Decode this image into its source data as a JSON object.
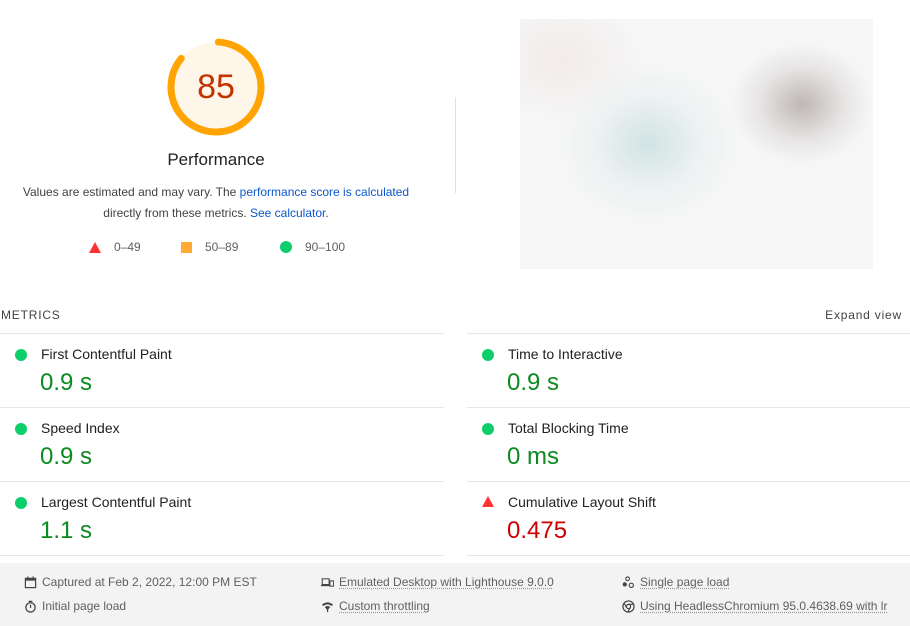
{
  "gauge": {
    "score": "85",
    "score_fraction": 0.85,
    "title": "Performance",
    "ring_color": "#ffa400",
    "fill_color": "#fff6ea",
    "text_color": "#c33300"
  },
  "description": {
    "text_before": "Values are estimated and may vary. The ",
    "link1": "performance score is calculated",
    "text_middle": " directly from these metrics. ",
    "link2": "See calculator",
    "text_after": "."
  },
  "legend": [
    {
      "shape": "triangle-icon",
      "range": "0–49",
      "color": "#ff3333"
    },
    {
      "shape": "square-icon",
      "range": "50–89",
      "color": "#ffaa33"
    },
    {
      "shape": "circle-icon",
      "range": "90–100",
      "color": "#0cce6b"
    }
  ],
  "metrics_section": {
    "heading": "METRICS",
    "expand_label": "Expand view",
    "items": [
      {
        "name": "First Contentful Paint",
        "value": "0.9 s",
        "status": "pass"
      },
      {
        "name": "Time to Interactive",
        "value": "0.9 s",
        "status": "pass"
      },
      {
        "name": "Speed Index",
        "value": "0.9 s",
        "status": "pass"
      },
      {
        "name": "Total Blocking Time",
        "value": "0 ms",
        "status": "pass"
      },
      {
        "name": "Largest Contentful Paint",
        "value": "1.1 s",
        "status": "pass"
      },
      {
        "name": "Cumulative Layout Shift",
        "value": "0.475",
        "status": "fail"
      }
    ]
  },
  "footer": {
    "captured": "Captured at Feb 2, 2022, 12:00 PM EST",
    "initial_load": "Initial page load",
    "device": "Emulated Desktop with Lighthouse 9.0.0",
    "throttling": "Custom throttling",
    "session": "Single page load",
    "browser": "Using HeadlessChromium 95.0.4638.69 with lr"
  }
}
